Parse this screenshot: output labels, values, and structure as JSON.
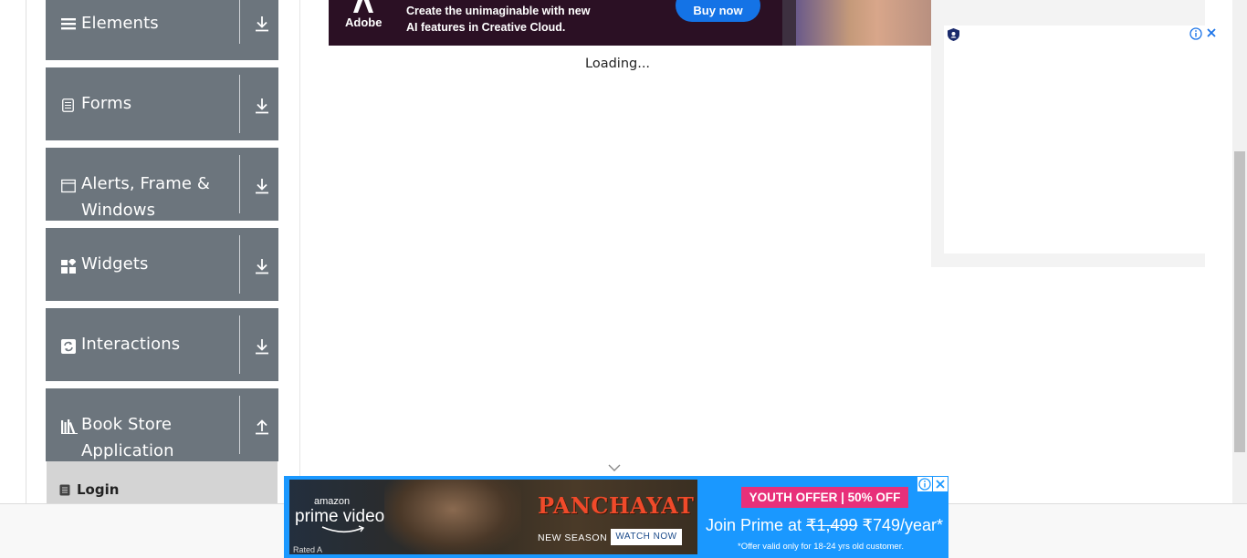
{
  "sidebar": {
    "groups": [
      {
        "label": "Elements",
        "icon": "hamburger-icon",
        "arrow": "down"
      },
      {
        "label": "Forms",
        "icon": "document-icon",
        "arrow": "down"
      },
      {
        "label": "Alerts, Frame &",
        "label_line2": "Windows",
        "icon": "window-icon",
        "arrow": "down"
      },
      {
        "label": "Widgets",
        "icon": "widgets-icon",
        "arrow": "down"
      },
      {
        "label": "Interactions",
        "icon": "interactions-icon",
        "arrow": "down"
      },
      {
        "label": "Book Store",
        "label_line2": "Application",
        "icon": "library-icon",
        "arrow": "up"
      }
    ],
    "active_item": {
      "label": "Login",
      "icon": "login-icon"
    }
  },
  "main": {
    "loading_text": "Loading..."
  },
  "top_ad": {
    "brand": "Adobe",
    "line1": "Create the unimaginable with new",
    "line2": "AI features in Creative Cloud.",
    "button": "Buy now"
  },
  "bottom_ad": {
    "brand_top": "amazon",
    "brand_main": "prime video",
    "rating": "Rated A",
    "show": "PANCHAYAT",
    "season": "NEW SEASON",
    "watch": "WATCH NOW",
    "offer": "YOUTH OFFER | 50% OFF",
    "join_prefix": "Join Prime at ",
    "old_price": "₹1,499",
    "new_price": " ₹749/year*",
    "fine_print": "*Offer valid only for 18-24 yrs old customer."
  },
  "colors": {
    "group_bg": "#6c757d",
    "active_bg": "#d4d4d4",
    "adobe_bg": "#2b1024",
    "adobe_button": "#1473e6",
    "prime_bg": "#1a98ff",
    "offer_pink": "#e8307a"
  }
}
